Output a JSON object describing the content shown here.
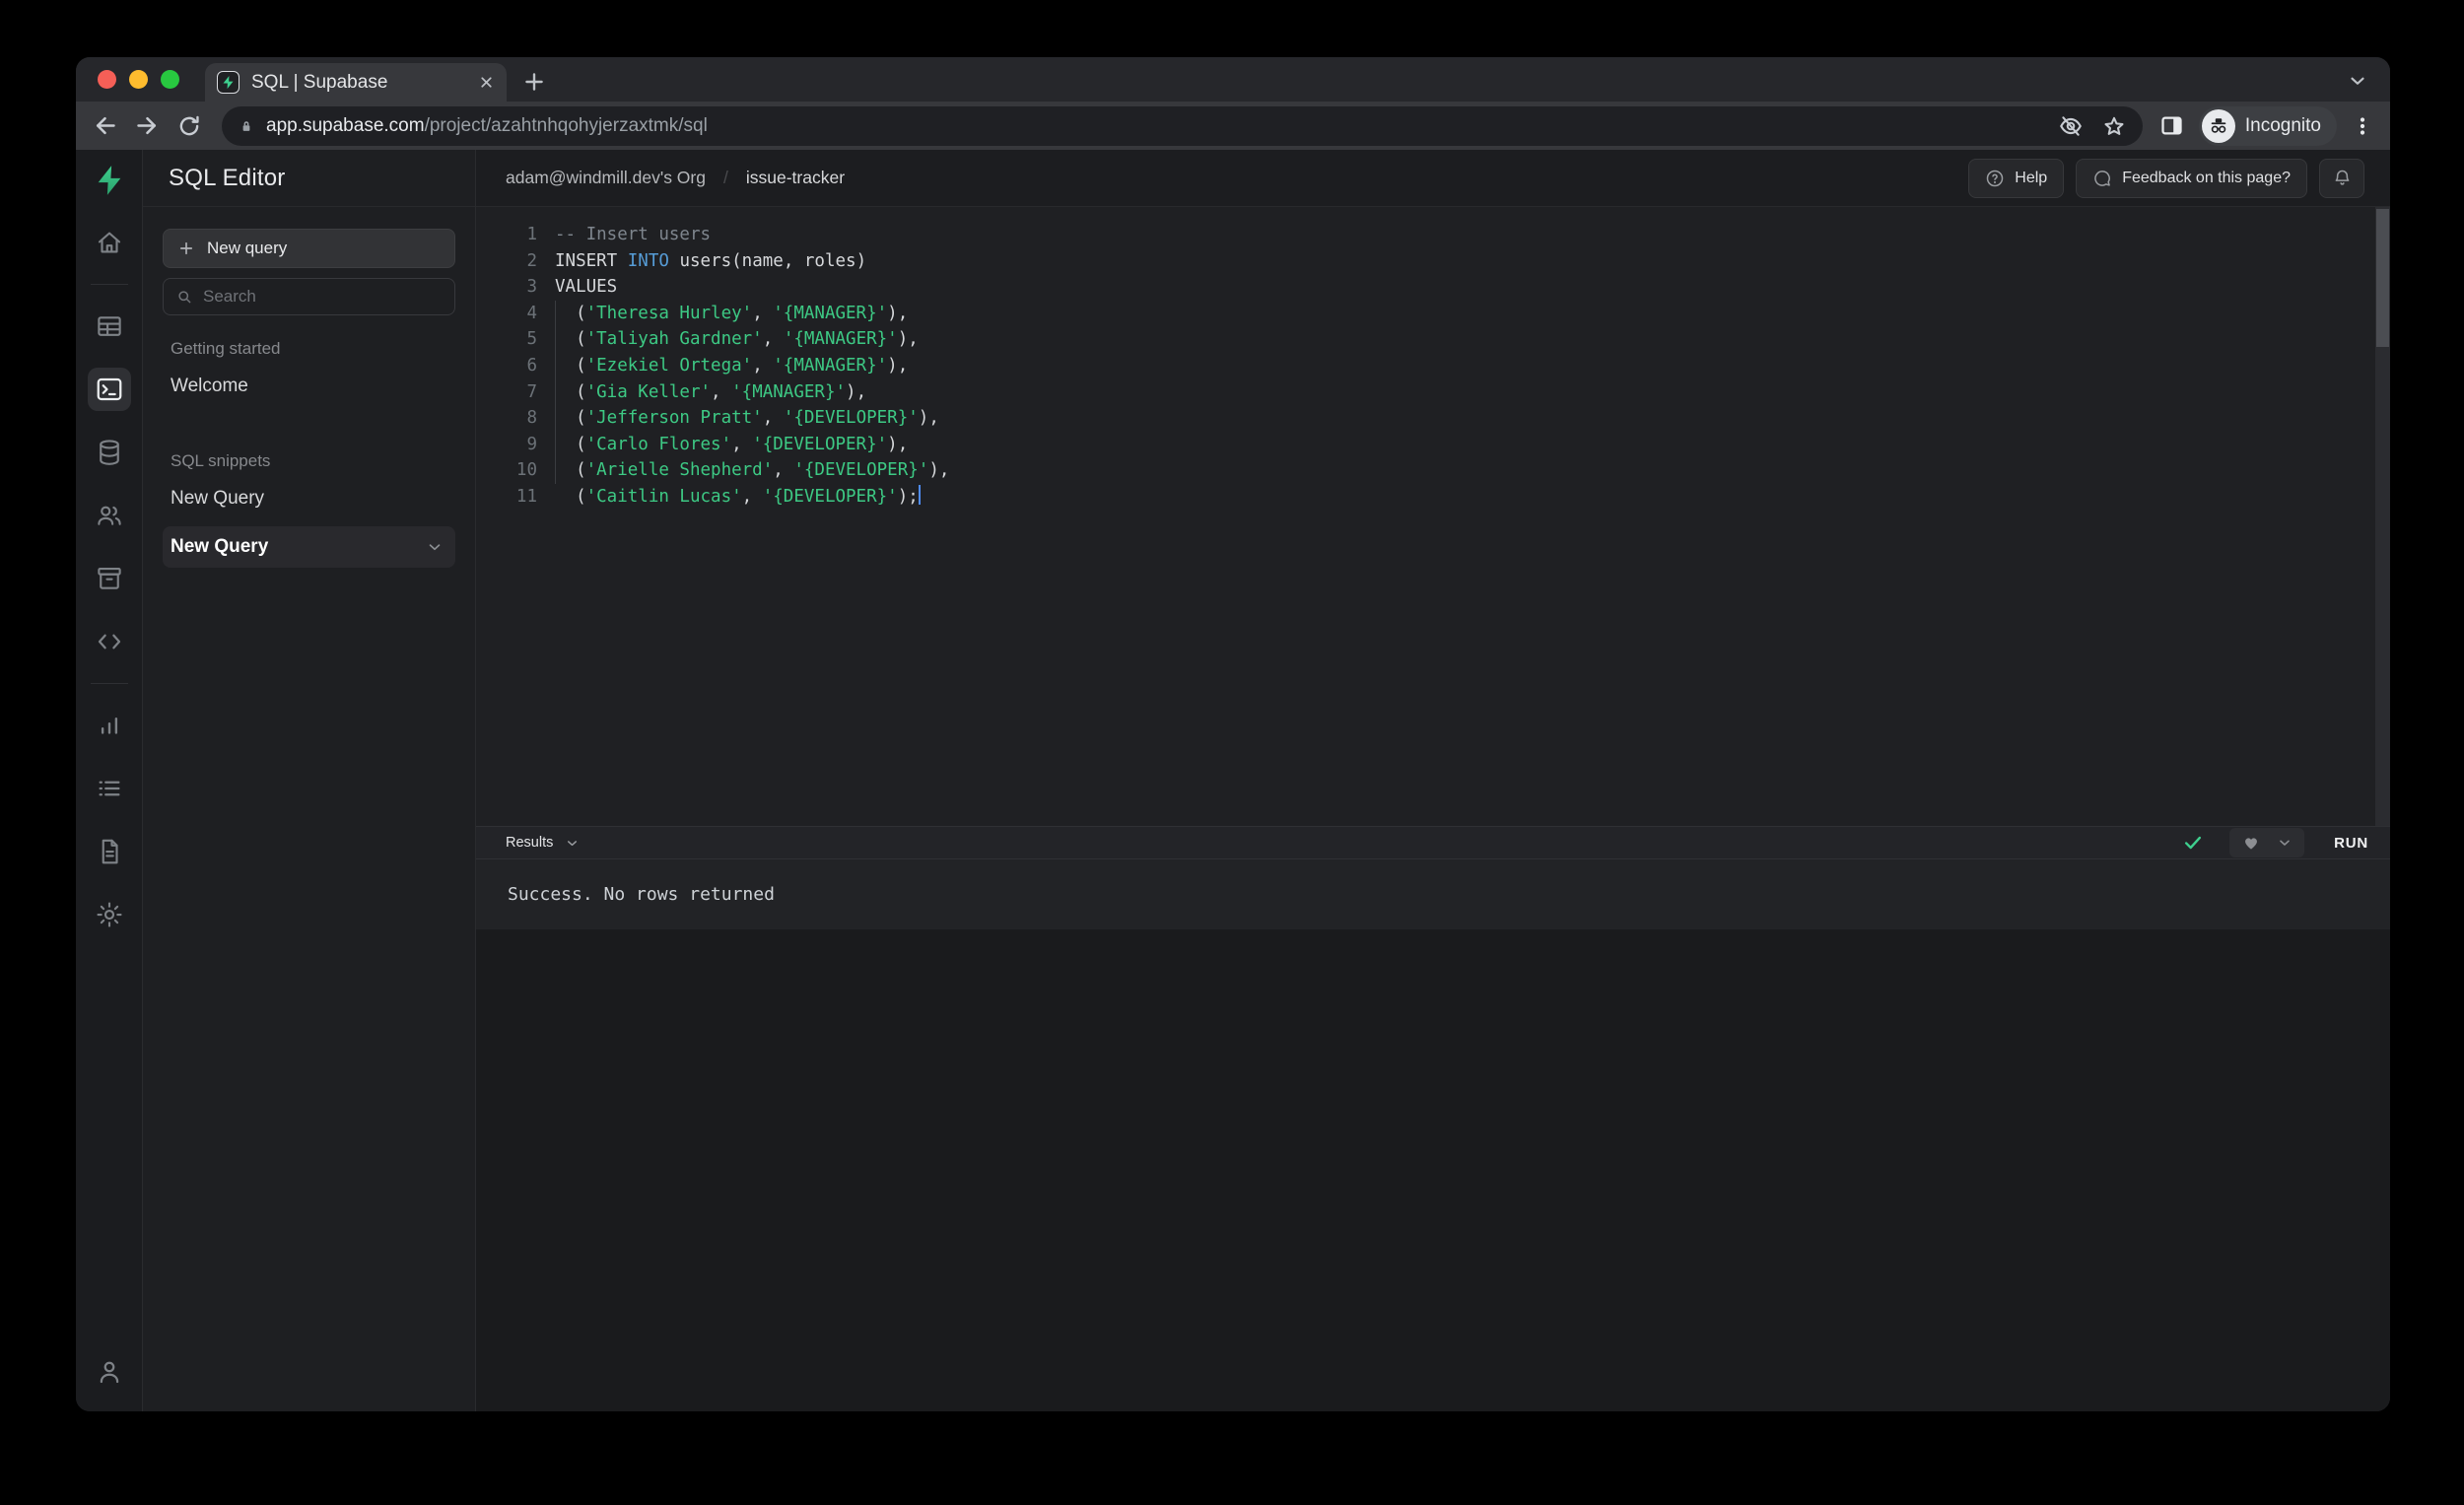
{
  "browser": {
    "tab": {
      "title": "SQL | Supabase"
    },
    "url": {
      "domain": "app.supabase.com",
      "path": "/project/azahtnhqohyjerzaxtmk/sql"
    },
    "incognito_label": "Incognito"
  },
  "rail": {
    "items": [
      {
        "name": "supabase-logo"
      },
      {
        "name": "home"
      },
      {
        "name": "table-editor"
      },
      {
        "name": "sql-editor",
        "active": true
      },
      {
        "name": "database"
      },
      {
        "name": "authentication"
      },
      {
        "name": "storage"
      },
      {
        "name": "edge-functions"
      },
      {
        "name": "reports"
      },
      {
        "name": "logs"
      },
      {
        "name": "docs"
      },
      {
        "name": "settings"
      },
      {
        "name": "account"
      }
    ]
  },
  "sidebar": {
    "title": "SQL Editor",
    "new_query_button": "New query",
    "search_placeholder": "Search",
    "sections": [
      {
        "label": "Getting started",
        "items": [
          {
            "label": "Welcome",
            "active": false
          }
        ]
      },
      {
        "label": "SQL snippets",
        "items": [
          {
            "label": "New Query",
            "active": false
          },
          {
            "label": "New Query",
            "active": true
          }
        ]
      }
    ]
  },
  "header": {
    "org": "adam@windmill.dev's Org",
    "separator": "/",
    "project": "issue-tracker",
    "help_label": "Help",
    "feedback_label": "Feedback on this page?"
  },
  "editor": {
    "lines": [
      {
        "n": 1,
        "parts": [
          [
            "comment",
            "-- Insert users"
          ]
        ]
      },
      {
        "n": 2,
        "parts": [
          [
            "plain",
            "INSERT "
          ],
          [
            "keyword",
            "INTO"
          ],
          [
            "plain",
            " users(name, roles)"
          ]
        ]
      },
      {
        "n": 3,
        "parts": [
          [
            "plain",
            "VALUES"
          ]
        ]
      },
      {
        "n": 4,
        "guide": true,
        "parts": [
          [
            "plain",
            "  ("
          ],
          [
            "string",
            "'Theresa Hurley'"
          ],
          [
            "plain",
            ", "
          ],
          [
            "string",
            "'{MANAGER}'"
          ],
          [
            "plain",
            "),"
          ]
        ]
      },
      {
        "n": 5,
        "guide": true,
        "parts": [
          [
            "plain",
            "  ("
          ],
          [
            "string",
            "'Taliyah Gardner'"
          ],
          [
            "plain",
            ", "
          ],
          [
            "string",
            "'{MANAGER}'"
          ],
          [
            "plain",
            "),"
          ]
        ]
      },
      {
        "n": 6,
        "guide": true,
        "parts": [
          [
            "plain",
            "  ("
          ],
          [
            "string",
            "'Ezekiel Ortega'"
          ],
          [
            "plain",
            ", "
          ],
          [
            "string",
            "'{MANAGER}'"
          ],
          [
            "plain",
            "),"
          ]
        ]
      },
      {
        "n": 7,
        "guide": true,
        "parts": [
          [
            "plain",
            "  ("
          ],
          [
            "string",
            "'Gia Keller'"
          ],
          [
            "plain",
            ", "
          ],
          [
            "string",
            "'{MANAGER}'"
          ],
          [
            "plain",
            "),"
          ]
        ]
      },
      {
        "n": 8,
        "guide": true,
        "parts": [
          [
            "plain",
            "  ("
          ],
          [
            "string",
            "'Jefferson Pratt'"
          ],
          [
            "plain",
            ", "
          ],
          [
            "string",
            "'{DEVELOPER}'"
          ],
          [
            "plain",
            "),"
          ]
        ]
      },
      {
        "n": 9,
        "guide": true,
        "parts": [
          [
            "plain",
            "  ("
          ],
          [
            "string",
            "'Carlo Flores'"
          ],
          [
            "plain",
            ", "
          ],
          [
            "string",
            "'{DEVELOPER}'"
          ],
          [
            "plain",
            "),"
          ]
        ]
      },
      {
        "n": 10,
        "guide": true,
        "parts": [
          [
            "plain",
            "  ("
          ],
          [
            "string",
            "'Arielle Shepherd'"
          ],
          [
            "plain",
            ", "
          ],
          [
            "string",
            "'{DEVELOPER}'"
          ],
          [
            "plain",
            "),"
          ]
        ]
      },
      {
        "n": 11,
        "parts": [
          [
            "plain",
            "  ("
          ],
          [
            "string",
            "'Caitlin Lucas'"
          ],
          [
            "plain",
            ", "
          ],
          [
            "string",
            "'{DEVELOPER}'"
          ],
          [
            "plain",
            ");"
          ],
          [
            "cursor",
            ""
          ]
        ]
      }
    ]
  },
  "results": {
    "label": "Results",
    "run_label": "RUN",
    "status": "Success. No rows returned"
  },
  "colors": {
    "accent": "#3ecf8e",
    "keyword": "#569cd6",
    "string": "#3dc984"
  }
}
